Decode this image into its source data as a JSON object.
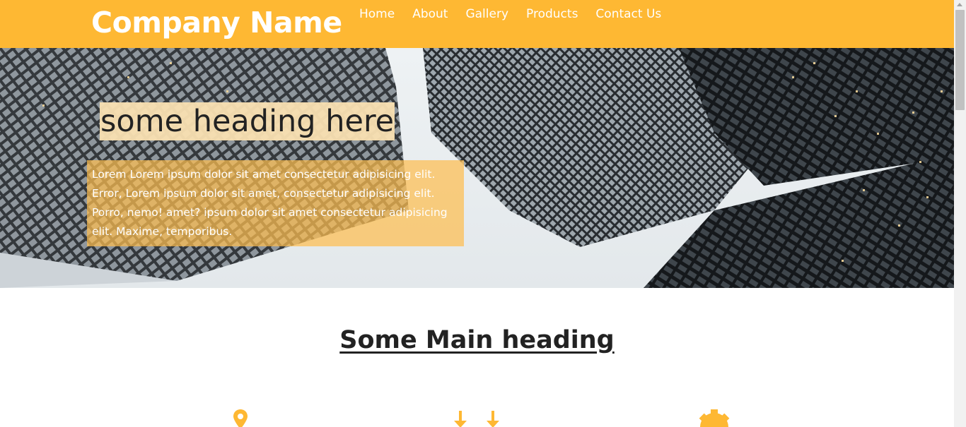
{
  "brand": {
    "name": "Company Name"
  },
  "nav": {
    "items": [
      {
        "label": "Home"
      },
      {
        "label": "About"
      },
      {
        "label": "Gallery"
      },
      {
        "label": "Products"
      },
      {
        "label": "Contact Us"
      }
    ]
  },
  "hero": {
    "heading": "some heading here",
    "paragraph": "Lorem Lorem ipsum dolor sit amet consectetur adipisicing elit. Error, Lorem ipsum dolor sit amet, consectetur adipisicing elit. Porro, nemo! amet? ipsum dolor sit amet consectetur adipisicing elit. Maxime, temporibus."
  },
  "main": {
    "heading": "Some Main heading"
  },
  "features": {
    "icons": [
      "map-marker-icon",
      "download-arrows-icon",
      "gear-icon"
    ]
  },
  "colors": {
    "accent": "#feb833",
    "heading_highlight": "#fae0b2",
    "text_dark": "#222222"
  }
}
